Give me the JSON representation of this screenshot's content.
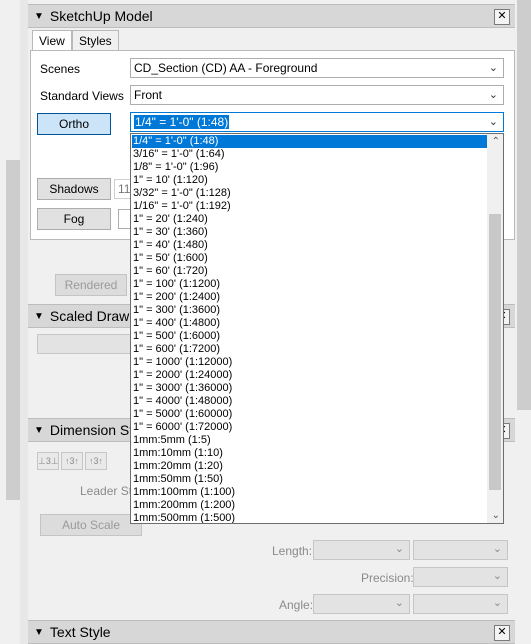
{
  "panels": {
    "sketchup_model": {
      "title": "SketchUp Model"
    },
    "scaled_drawing": {
      "title": "Scaled Drawi"
    },
    "dimension_styles": {
      "title": "Dimension St"
    },
    "text_style": {
      "title": "Text Style"
    }
  },
  "tabs": [
    "View",
    "Styles"
  ],
  "view": {
    "scenes_label": "Scenes",
    "scenes_value": "CD_Section (CD) AA - Foreground",
    "standard_views_label": "Standard Views",
    "standard_views_value": "Front",
    "ortho_label": "Ortho",
    "scale_value": "1/4\" = 1'-0\" (1:48)",
    "shadows_label": "Shadows",
    "shadows_value": "11",
    "fog_label": "Fog",
    "rendered_label": "Rendered"
  },
  "dimension": {
    "leader_label": "Leader Sty",
    "auto_scale_label": "Auto Scale",
    "length_label": "Length:",
    "precision_label": "Precision:",
    "angle_label": "Angle:",
    "icons": [
      "⊥3⊥",
      "↑3↑",
      "↑3↑"
    ]
  },
  "scale_options": [
    "1/4\" = 1'-0\" (1:48)",
    "3/16\" = 1'-0\" (1:64)",
    "1/8\" = 1'-0\" (1:96)",
    "1\" = 10' (1:120)",
    "3/32\" = 1'-0\" (1:128)",
    "1/16\" = 1'-0\" (1:192)",
    "1\" = 20' (1:240)",
    "1\" = 30' (1:360)",
    "1\" = 40' (1:480)",
    "1\" = 50' (1:600)",
    "1\" = 60' (1:720)",
    "1\" = 100' (1:1200)",
    "1\" = 200' (1:2400)",
    "1\" = 300' (1:3600)",
    "1\" = 400' (1:4800)",
    "1\" = 500' (1:6000)",
    "1\" = 600' (1:7200)",
    "1\" = 1000' (1:12000)",
    "1\" = 2000' (1:24000)",
    "1\" = 3000' (1:36000)",
    "1\" = 4000' (1:48000)",
    "1\" = 5000' (1:60000)",
    "1\" = 6000' (1:72000)",
    "1mm:5mm (1:5)",
    "1mm:10mm (1:10)",
    "1mm:20mm (1:20)",
    "1mm:50mm (1:50)",
    "1mm:100mm (1:100)",
    "1mm:200mm (1:200)",
    "1mm:500mm (1:500)"
  ],
  "selected_index": 0
}
